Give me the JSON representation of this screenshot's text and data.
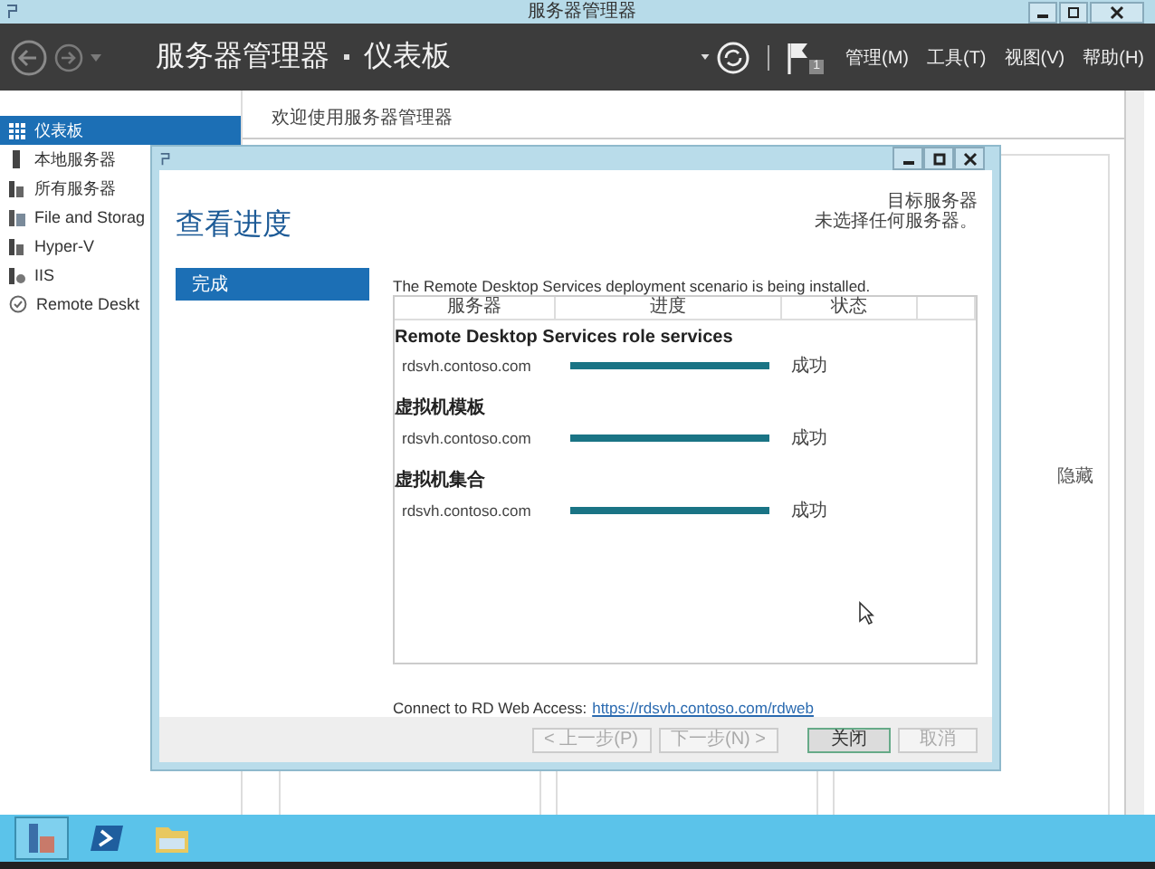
{
  "window": {
    "title": "服务器管理器"
  },
  "header": {
    "breadcrumb": "服务器管理器",
    "page": "仪表板",
    "flag_count": "1",
    "menus": [
      "管理(M)",
      "工具(T)",
      "视图(V)",
      "帮助(H)"
    ]
  },
  "sidebar": {
    "items": [
      {
        "label": "仪表板",
        "kind": "dashboard",
        "selected": true
      },
      {
        "label": "本地服务器",
        "kind": "server",
        "selected": false
      },
      {
        "label": "所有服务器",
        "kind": "servers",
        "selected": false
      },
      {
        "label": "File and Storag",
        "kind": "storage",
        "selected": false
      },
      {
        "label": "Hyper-V",
        "kind": "servers",
        "selected": false
      },
      {
        "label": "IIS",
        "kind": "iis",
        "selected": false
      },
      {
        "label": "Remote Deskt",
        "kind": "remote",
        "selected": false
      }
    ]
  },
  "main": {
    "welcome": "欢迎使用服务器管理器",
    "hide_link": "隐藏"
  },
  "dialog": {
    "heading": "查看进度",
    "target_title": "目标服务器",
    "target_text": "未选择任何服务器。",
    "steps": [
      {
        "label": "完成",
        "selected": true
      }
    ],
    "intro": "The Remote Desktop Services deployment scenario is being installed.",
    "columns": [
      "服务器",
      "进度",
      "状态"
    ],
    "groups": [
      {
        "title": "Remote Desktop Services role services",
        "rows": [
          {
            "server": "rdsvh.contoso.com",
            "level": 1,
            "status": "成功"
          }
        ]
      },
      {
        "title": "虚拟机模板",
        "rows": [
          {
            "server": "rdsvh.contoso.com",
            "level": 1,
            "status": "成功"
          }
        ]
      },
      {
        "title": "虚拟机集合",
        "rows": [
          {
            "server": "rdsvh.contoso.com",
            "level": 1,
            "status": "成功"
          }
        ]
      }
    ],
    "link_label": "Connect to RD Web Access:",
    "link": "https://rdsvh.contoso.com/rdweb",
    "buttons": [
      {
        "label": "< 上一步(P)",
        "disabled": true,
        "default": false
      },
      {
        "label": "下一步(N) >",
        "disabled": true,
        "default": false
      },
      {
        "label": "关闭",
        "disabled": false,
        "default": true
      },
      {
        "label": "取消",
        "disabled": true,
        "default": false
      }
    ]
  },
  "taskbar": {
    "apps": [
      {
        "kind": "server-manager",
        "selected": true
      },
      {
        "kind": "powershell",
        "selected": false
      },
      {
        "kind": "explorer",
        "selected": false
      }
    ]
  }
}
